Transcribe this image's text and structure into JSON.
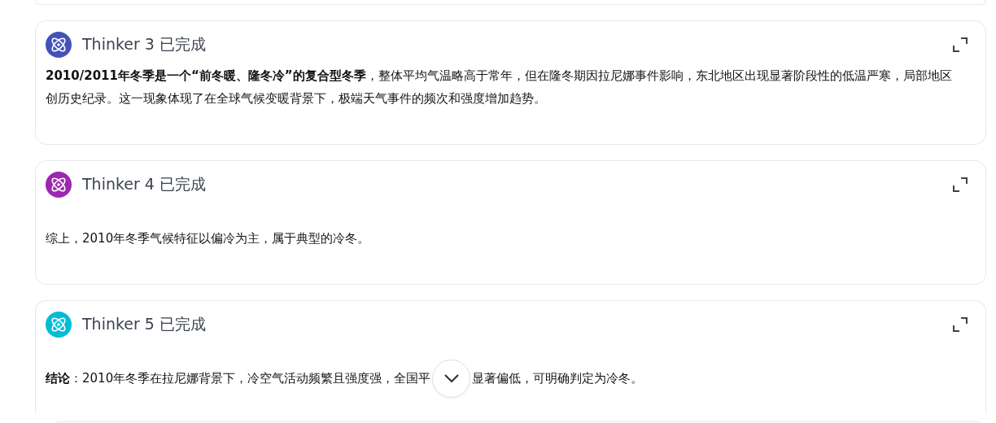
{
  "cards": [
    {
      "title": "Thinker 3 已完成",
      "color": "#4352b8",
      "text": [
        "**2010/2011年冬季是一个“前冬暖、隆冬冷”的复合型冬季**，整体平均气温略高于常年，但在隆冬期因拉尼娜事件影响，东北地区出现显著阶段性的低温严寒，局部地区创历史纪录。这一现象体现了在全球气候变暖背景下，极端天气事件的频次和强度增加趋势。"
      ]
    },
    {
      "title": "Thinker 4 已完成",
      "color": "#9c27b0",
      "text": [
        "综上，2010年冬季气候特征以偏冷为主，属于典型的冷冬。"
      ]
    },
    {
      "title": "Thinker 5 已完成",
      "color": "#00bcd4",
      "text": [
        "**结论**：2010年冬季在拉尼娜背景下，冷空气活动频繁且强度强，全国平",
        "显著偏低，可明确判定为冷冬。"
      ]
    }
  ]
}
